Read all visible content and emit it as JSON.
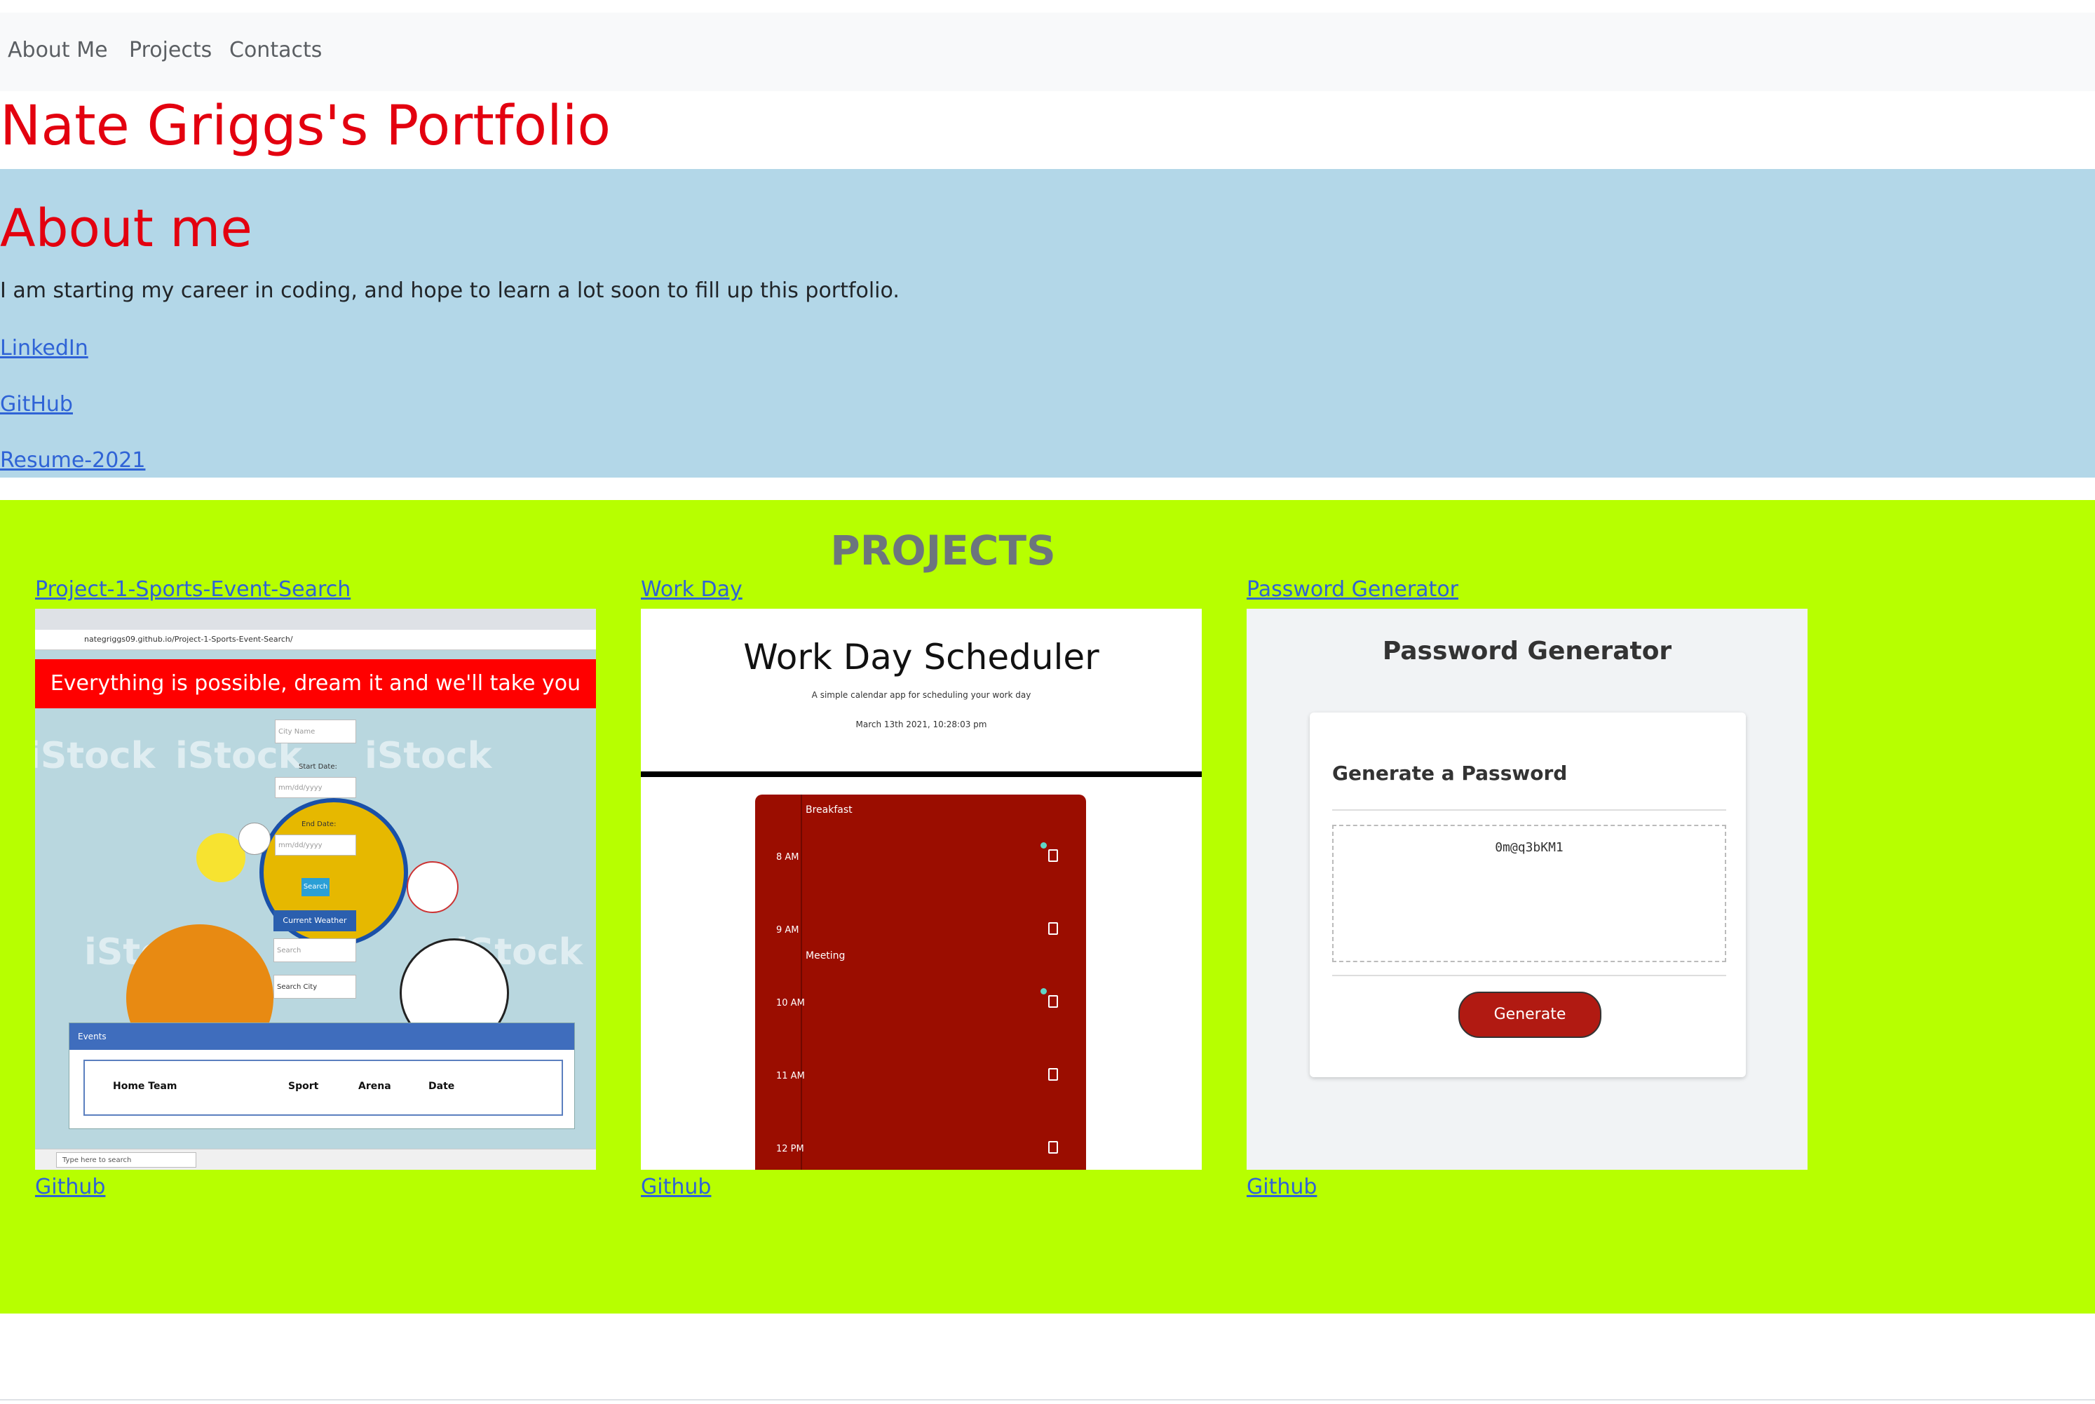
{
  "nav": {
    "items": [
      "About Me",
      "Projects",
      "Contacts"
    ]
  },
  "header": {
    "title": "Nate Griggs's Portfolio"
  },
  "about": {
    "heading": "About me",
    "text": "I am starting my career in coding, and hope to learn a lot soon to fill up this portfolio.",
    "links": [
      "LinkedIn",
      "GitHub",
      "Resume-2021"
    ]
  },
  "projects": {
    "heading": "PROJECTS",
    "items": [
      {
        "title": "Project-1-Sports-Event-Search",
        "github_label": "Github",
        "screenshot": {
          "url_text": "nategriggs09.github.io/Project-1-Sports-Event-Search/",
          "banner": "Everything is possible, dream it and we'll take you there!!",
          "watermark": "iStock",
          "city_placeholder": "City Name",
          "start_label": "Start Date:",
          "end_label": "End Date:",
          "date_placeholder": "mm/dd/yyyy",
          "search_button": "Search",
          "weather_heading": "Current Weather Search",
          "weather_placeholder": "Search",
          "search_city": "Search City",
          "events_heading": "Events",
          "columns": [
            "Home Team",
            "Sport",
            "Arena",
            "Date"
          ],
          "taskbar_search": "Type here to search"
        }
      },
      {
        "title": "Work Day",
        "github_label": "Github",
        "screenshot": {
          "title": "Work Day Scheduler",
          "subtitle": "A simple calendar app for scheduling your work day",
          "date": "March 13th 2021, 10:28:03 pm",
          "hours": [
            "8 AM",
            "9 AM",
            "10 AM",
            "11 AM",
            "12 PM"
          ],
          "events": [
            "Breakfast",
            "Meeting"
          ]
        }
      },
      {
        "title": "Password Generator",
        "github_label": "Github",
        "screenshot": {
          "title": "Password Generator",
          "card_heading": "Generate a Password",
          "password": "0m@q3bKM1",
          "button": "Generate Password"
        }
      }
    ]
  },
  "colors": {
    "title_red": "#e3000f",
    "about_bg": "#b3d7e8",
    "projects_bg": "#b7ff00",
    "link_blue": "#2f63d6",
    "nav_bg": "#f8f9fa"
  }
}
